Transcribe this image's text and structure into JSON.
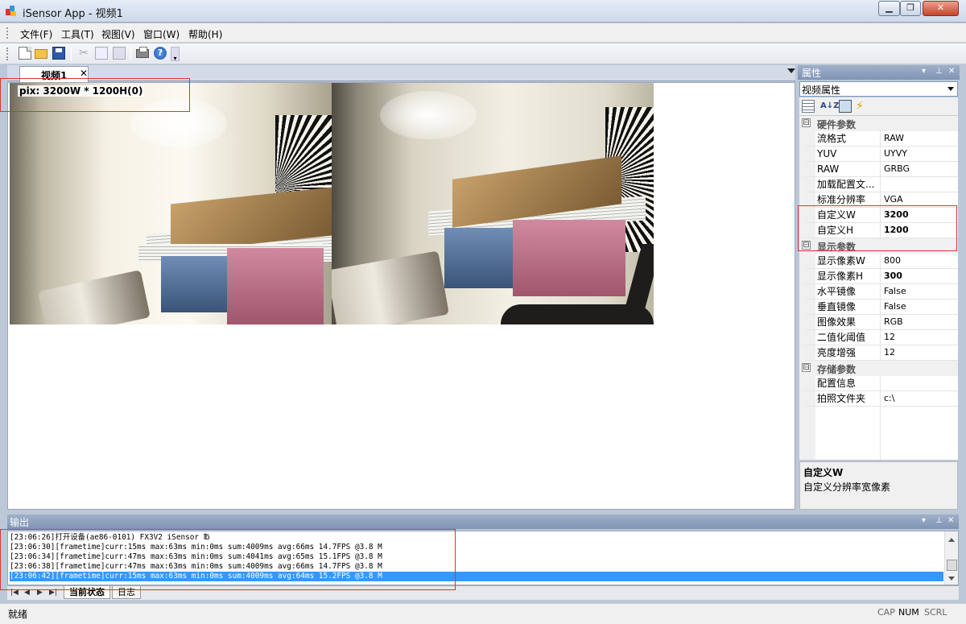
{
  "window": {
    "title": "iSensor App - 视频1",
    "min": "▁",
    "max": "❐",
    "close": "✕"
  },
  "menu": [
    {
      "label": "文件(F)"
    },
    {
      "label": "工具(T)"
    },
    {
      "label": "视图(V)"
    },
    {
      "label": "窗口(W)"
    },
    {
      "label": "帮助(H)"
    }
  ],
  "toolbar": {
    "icons": [
      "new-file-icon",
      "open-folder-icon",
      "save-icon",
      "cut-icon",
      "copy-icon",
      "paste-icon",
      "print-icon",
      "help-icon"
    ]
  },
  "doc_tab": {
    "label": "视频1",
    "close": "✕"
  },
  "video": {
    "pix_label": "pix: 3200W * 1200H(0)"
  },
  "properties": {
    "title": "属性",
    "header_buttons": [
      "▾",
      "⊥",
      "✕"
    ],
    "selector": "视频属性",
    "categories": [
      {
        "name": "硬件参数",
        "toggle": "⊟",
        "rows": [
          {
            "name": "流格式",
            "value": "RAW",
            "bold": false
          },
          {
            "name": "YUV",
            "value": "UYVY",
            "bold": false
          },
          {
            "name": "RAW",
            "value": "GRBG",
            "bold": false
          },
          {
            "name": "加载配置文...",
            "value": "",
            "bold": false
          },
          {
            "name": "标准分辨率",
            "value": "VGA",
            "bold": false
          },
          {
            "name": "自定义W",
            "value": "3200",
            "bold": true
          },
          {
            "name": "自定义H",
            "value": "1200",
            "bold": true
          }
        ]
      },
      {
        "name": "显示参数",
        "toggle": "⊟",
        "rows": [
          {
            "name": "显示像素W",
            "value": "800",
            "bold": false
          },
          {
            "name": "显示像素H",
            "value": "300",
            "bold": true
          },
          {
            "name": "水平镜像",
            "value": "False",
            "bold": false
          },
          {
            "name": "垂直镜像",
            "value": "False",
            "bold": false
          },
          {
            "name": "图像效果",
            "value": "RGB",
            "bold": false
          },
          {
            "name": "二值化阈值",
            "value": "12",
            "bold": false
          },
          {
            "name": "亮度增强",
            "value": "12",
            "bold": false
          }
        ]
      },
      {
        "name": "存储参数",
        "toggle": "⊟",
        "rows": [
          {
            "name": "配置信息",
            "value": "",
            "bold": false
          },
          {
            "name": "拍照文件夹",
            "value": "c:\\",
            "bold": false
          }
        ]
      }
    ],
    "description": {
      "title": "自定义W",
      "text": "自定义分辨率宽像素"
    }
  },
  "output": {
    "title": "输出",
    "header_buttons": [
      "▾",
      "⊥",
      "✕"
    ],
    "lines": [
      "[23:06:26]打开设备(ae86-0101) FX3V2 iSensor ℔",
      "[23:06:30][frametime]curr:15ms max:63ms min:0ms sum:4009ms avg:66ms 14.7FPS @3.8 M",
      "[23:06:34][frametime]curr:47ms max:63ms min:0ms sum:4041ms avg:65ms 15.1FPS @3.8 M",
      "[23:06:38][frametime]curr:47ms max:63ms min:0ms sum:4009ms avg:66ms 14.7FPS @3.8 M",
      "[23:06:42][frametime]curr:15ms max:63ms min:0ms sum:4009ms avg:64ms 15.2FPS @3.8 M"
    ],
    "selected_index": 4,
    "nav": [
      "|◀",
      "◀",
      "▶",
      "▶|"
    ],
    "tabs": [
      {
        "label": "当前状态",
        "active": true
      },
      {
        "label": "日志",
        "active": false
      }
    ]
  },
  "status": {
    "text": "就绪",
    "indicators": [
      {
        "label": "CAP",
        "on": false
      },
      {
        "label": "NUM",
        "on": true
      },
      {
        "label": "SCRL",
        "on": false
      }
    ]
  }
}
